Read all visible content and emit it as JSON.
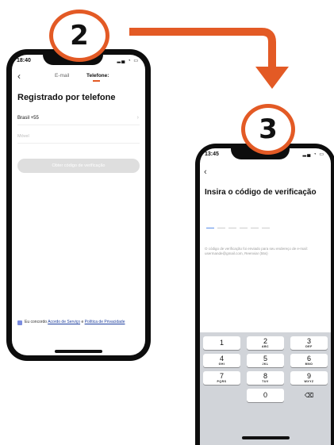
{
  "steps": {
    "first": "2",
    "second": "3"
  },
  "colors": {
    "accent": "#e35a25",
    "keypad_bg": "#d1d4d9",
    "input_active": "#5a8ee8",
    "link": "#1d3e9e"
  },
  "phone1": {
    "time": "18:40",
    "status_icons": "signal-wifi-battery",
    "back_icon": "‹",
    "tab_email": "E-mail",
    "tab_phone": "Telefone:",
    "title": "Registrado por telefone",
    "country": "Brasil +55",
    "mobile_placeholder": "Móvel",
    "get_code_button": "Obter código de verificação",
    "agree_prefix": "Eu concordo",
    "terms_link": "Acordo de Serviço",
    "agree_and": "e",
    "privacy_link": "Política de Privacidade"
  },
  "phone2": {
    "time": "13:45",
    "status_icons": "signal-wifi-battery",
    "back_icon": "‹",
    "title": "Insira o código de verificação",
    "info_text": "O código de verificação foi enviado para seu endereço de e-mail: usermande@gmail.com, Reenviar (55s)",
    "keys": [
      {
        "num": "1",
        "sub": ""
      },
      {
        "num": "2",
        "sub": "ABC"
      },
      {
        "num": "3",
        "sub": "DEF"
      },
      {
        "num": "4",
        "sub": "GHI"
      },
      {
        "num": "5",
        "sub": "JKL"
      },
      {
        "num": "6",
        "sub": "MNO"
      },
      {
        "num": "7",
        "sub": "PQRS"
      },
      {
        "num": "8",
        "sub": "TUV"
      },
      {
        "num": "9",
        "sub": "WXYZ"
      },
      {
        "num": "0",
        "sub": ""
      }
    ],
    "delete_icon": "⌫"
  }
}
